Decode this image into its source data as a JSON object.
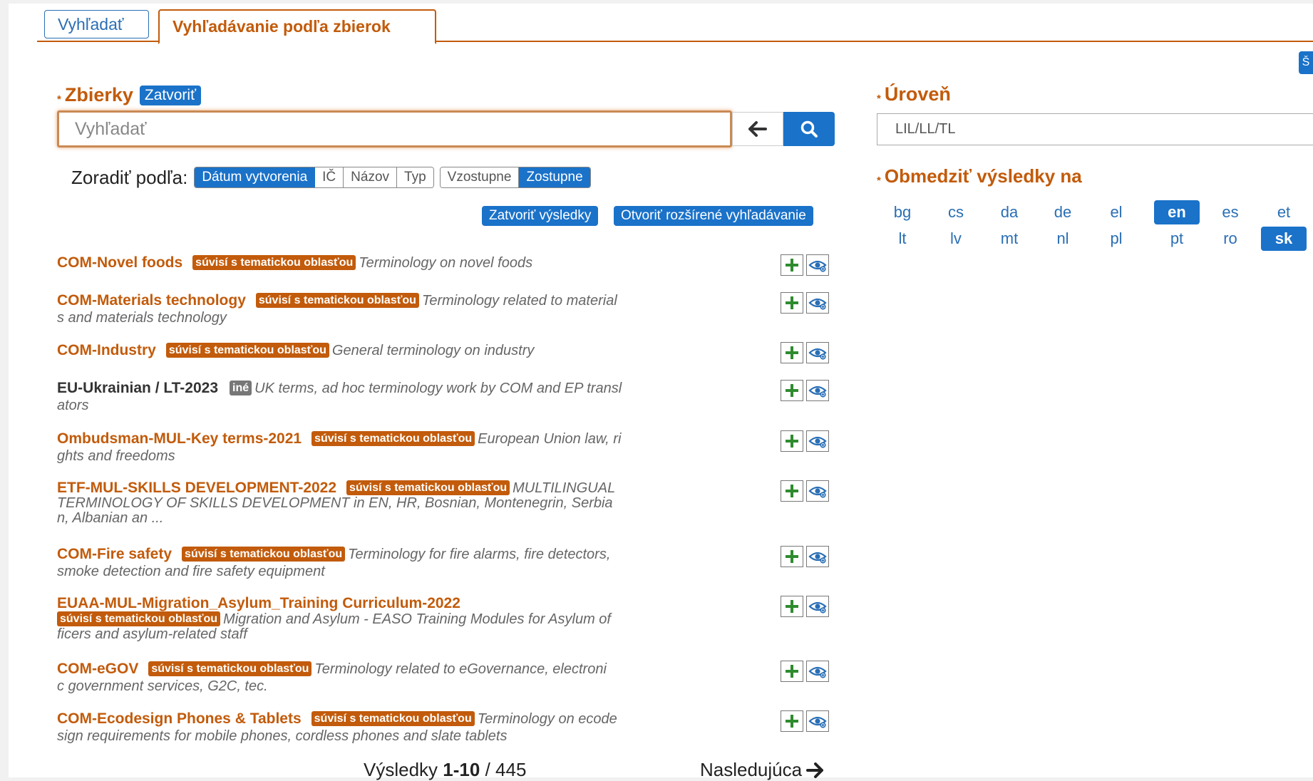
{
  "tabs": [
    {
      "label": "Vyhľadať",
      "active": false
    },
    {
      "label": "Vyhľadávanie podľa zbierok",
      "active": true
    }
  ],
  "corner_button": "Š",
  "collections": {
    "title": "Zbierky",
    "close_label": "Zatvoriť",
    "search_placeholder": "Vyhľadať",
    "back_icon": "arrow-left-icon",
    "search_icon": "search-icon"
  },
  "sort": {
    "label": "Zoradiť podľa:",
    "fields": [
      {
        "label": "Dátum vytvorenia",
        "selected": true
      },
      {
        "label": "IČ",
        "selected": false
      },
      {
        "label": "Názov",
        "selected": false
      },
      {
        "label": "Typ",
        "selected": false
      }
    ],
    "order": [
      {
        "label": "Vzostupne",
        "selected": false
      },
      {
        "label": "Zostupne",
        "selected": true
      }
    ]
  },
  "actions": {
    "close_results": "Zatvoriť výsledky",
    "open_advanced": "Otvoriť rozšírené vyhľadávanie"
  },
  "results": [
    {
      "title": "COM-Novel foods",
      "tag": "súvisí s tematickou oblasťou",
      "desc_lines": [
        "Terminology on novel foods"
      ]
    },
    {
      "title": "COM-Materials technology",
      "tag": "súvisí s tematickou oblasťou",
      "desc_lines": [
        "Terminology related to material",
        "s and materials technology"
      ]
    },
    {
      "title": "COM-Industry",
      "tag": "súvisí s tematickou oblasťou",
      "desc_lines": [
        "General terminology on industry"
      ]
    },
    {
      "title": "EU-Ukrainian / LT-2023",
      "tag": "iné",
      "desc_lines": [
        "UK terms, ad hoc terminology work by COM and EP transl",
        "ators"
      ]
    },
    {
      "title": "Ombudsman-MUL-Key terms-2021",
      "tag": "súvisí s tematickou oblasťou",
      "desc_lines": [
        "European Union law, ri",
        "ghts and freedoms"
      ]
    },
    {
      "title": "ETF-MUL-SKILLS DEVELOPMENT-2022",
      "tag": "súvisí s tematickou oblasťou",
      "desc_lines": [
        "MULTILINGUAL",
        "TERMINOLOGY OF SKILLS DEVELOPMENT in EN, HR, Bosnian, Montenegrin, Serbia",
        "n, Albanian an ..."
      ]
    },
    {
      "title": "COM-Fire safety",
      "tag": "súvisí s tematickou oblasťou",
      "desc_lines": [
        "Terminology for fire alarms, fire detectors,",
        "smoke detection and fire safety equipment"
      ]
    },
    {
      "title": "EUAA-MUL-Migration_Asylum_Training Curriculum-2022",
      "tag": "súvisí s tematickou oblasťou",
      "desc_lines": [
        "Migration and Asylum - EASO Training Modules for Asylum of",
        "ficers and asylum-related staff"
      ]
    },
    {
      "title": "COM-eGOV",
      "tag": "súvisí s tematickou oblasťou",
      "desc_lines": [
        "Terminology related to eGovernance, electroni",
        "c government services, G2C, tec."
      ]
    },
    {
      "title": "COM-Ecodesign Phones & Tablets",
      "tag": "súvisí s tematickou oblasťou",
      "desc_lines": [
        "Terminology on ecode",
        "sign requirements for mobile phones, cordless phones and slate tablets"
      ]
    }
  ],
  "result_icons": [
    "plus-icon",
    "eye-icon"
  ],
  "pagination": {
    "prefix": "Výsledky",
    "range": "1-10",
    "separator": "/",
    "total": "445",
    "next": "Nasledujúca"
  },
  "level": {
    "title": "Úroveň",
    "value": "LIL/LL/TL"
  },
  "restrict": {
    "title": "Obmedziť výsledky na",
    "languages": [
      {
        "code": "bg",
        "selected": false
      },
      {
        "code": "cs",
        "selected": false
      },
      {
        "code": "da",
        "selected": false
      },
      {
        "code": "de",
        "selected": false
      },
      {
        "code": "el",
        "selected": false
      },
      {
        "code": "en",
        "selected": true
      },
      {
        "code": "es",
        "selected": false
      },
      {
        "code": "et",
        "selected": false
      },
      {
        "code": "lt",
        "selected": false
      },
      {
        "code": "lv",
        "selected": false
      },
      {
        "code": "mt",
        "selected": false
      },
      {
        "code": "nl",
        "selected": false
      },
      {
        "code": "pl",
        "selected": false
      },
      {
        "code": "pt",
        "selected": false
      },
      {
        "code": "ro",
        "selected": false
      },
      {
        "code": "sk",
        "selected": true
      }
    ]
  },
  "colors": {
    "accent_orange": "#c25b0b",
    "primary_blue": "#1a72c9",
    "plus_green": "#2e8b2e"
  }
}
